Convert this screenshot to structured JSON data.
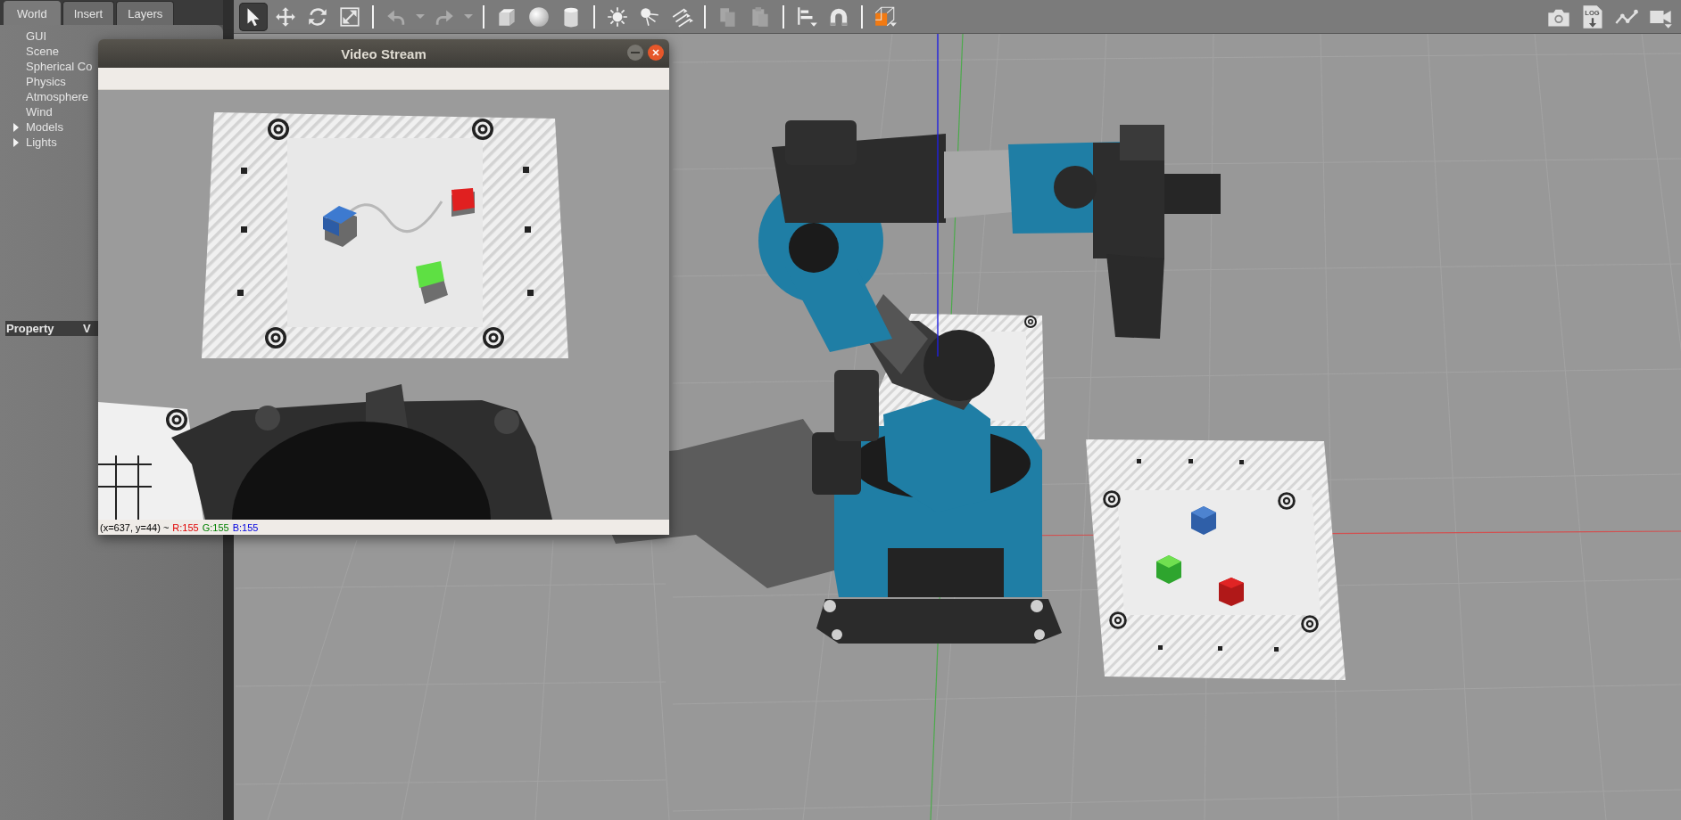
{
  "panel": {
    "tabs": [
      {
        "label": "World",
        "selected": true
      },
      {
        "label": "Insert",
        "selected": false
      },
      {
        "label": "Layers",
        "selected": false
      }
    ],
    "tree": [
      {
        "label": "GUI"
      },
      {
        "label": "Scene"
      },
      {
        "label": "Spherical Co"
      },
      {
        "label": "Physics"
      },
      {
        "label": "Atmosphere"
      },
      {
        "label": "Wind"
      },
      {
        "label": "Models",
        "expanded": false
      },
      {
        "label": "Lights",
        "expanded": false
      }
    ],
    "property_columns": [
      "Property",
      "V"
    ]
  },
  "toolbar": {
    "groups": [
      [
        {
          "kind": "select",
          "selected": true,
          "disabled": false
        },
        {
          "kind": "translate",
          "selected": false,
          "disabled": false
        },
        {
          "kind": "rotate",
          "selected": false,
          "disabled": false
        },
        {
          "kind": "scale",
          "selected": false,
          "disabled": false
        }
      ],
      [
        {
          "kind": "undo",
          "disabled": true
        },
        {
          "kind": "dropdown",
          "disabled": true
        },
        {
          "kind": "redo",
          "disabled": true
        },
        {
          "kind": "dropdown",
          "disabled": true
        }
      ],
      [
        {
          "kind": "box",
          "disabled": false
        },
        {
          "kind": "sphere",
          "disabled": false
        },
        {
          "kind": "cylinder",
          "disabled": false
        }
      ],
      [
        {
          "kind": "point-light",
          "disabled": false
        },
        {
          "kind": "spot-light",
          "disabled": false
        },
        {
          "kind": "directional-light",
          "disabled": false
        }
      ],
      [
        {
          "kind": "copy",
          "disabled": true
        },
        {
          "kind": "paste",
          "disabled": true
        }
      ],
      [
        {
          "kind": "align",
          "disabled": false
        },
        {
          "kind": "magnet",
          "disabled": false
        }
      ],
      [
        {
          "kind": "view-angle",
          "disabled": false
        }
      ]
    ],
    "right_tools": [
      {
        "kind": "camera"
      },
      {
        "kind": "log",
        "label": "LOG"
      },
      {
        "kind": "plot"
      },
      {
        "kind": "video"
      }
    ]
  },
  "video_window": {
    "title": "Video Stream",
    "status": [
      {
        "text": "(x=637, y=44) ~",
        "color": "#000000"
      },
      {
        "text": "R:155",
        "color": "#e00000"
      },
      {
        "text": "G:155",
        "color": "#008000"
      },
      {
        "text": "B:155",
        "color": "#0000e0"
      }
    ]
  }
}
